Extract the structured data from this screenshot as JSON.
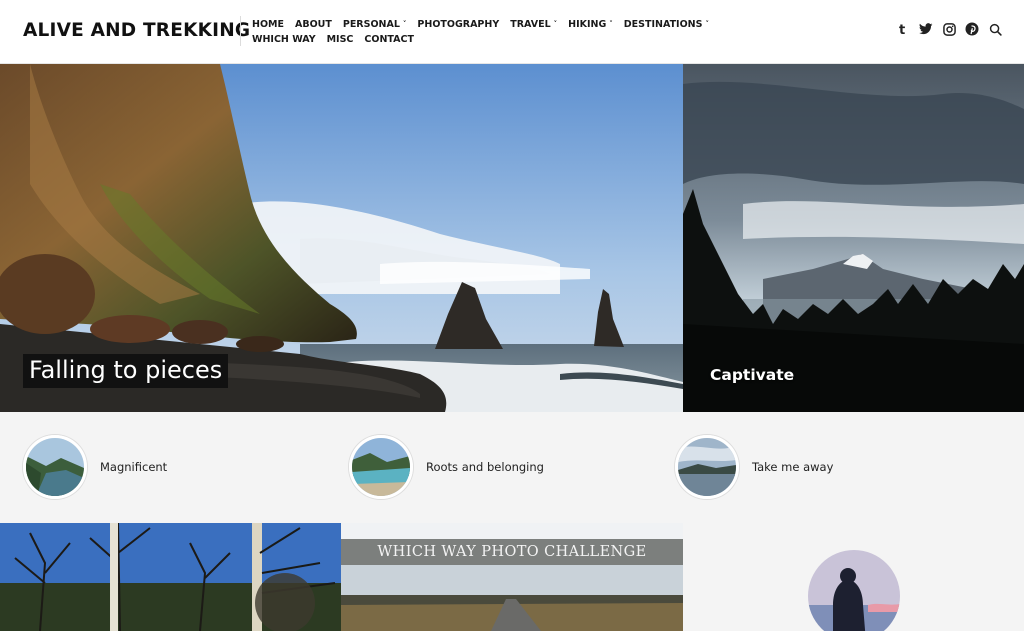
{
  "site": {
    "title": "ALIVE AND TREKKING"
  },
  "nav": {
    "row1": [
      {
        "label": "HOME",
        "dropdown": false
      },
      {
        "label": "ABOUT",
        "dropdown": false
      },
      {
        "label": "PERSONAL",
        "dropdown": true
      },
      {
        "label": "PHOTOGRAPHY",
        "dropdown": false
      },
      {
        "label": "TRAVEL",
        "dropdown": true
      },
      {
        "label": "HIKING",
        "dropdown": true
      },
      {
        "label": "DESTINATIONS",
        "dropdown": true
      }
    ],
    "row2": [
      {
        "label": "WHICH WAY",
        "dropdown": false
      },
      {
        "label": "MISC",
        "dropdown": false
      },
      {
        "label": "CONTACT",
        "dropdown": false
      }
    ]
  },
  "social": [
    "tumblr-icon",
    "twitter-icon",
    "instagram-icon",
    "pinterest-icon",
    "search-icon"
  ],
  "hero": {
    "main_title": "Falling to pieces",
    "side_title": "Captivate"
  },
  "mini_posts": [
    {
      "title": "Magnificent"
    },
    {
      "title": "Roots and belonging"
    },
    {
      "title": "Take me away"
    }
  ],
  "bottom": {
    "banner": "WHICH WAY PHOTO CHALLENGE"
  },
  "colors": {
    "header_bg": "#ffffff",
    "page_bg": "#f4f4f4",
    "title_box": "#111111",
    "banner_bg": "#7c7f7d"
  }
}
